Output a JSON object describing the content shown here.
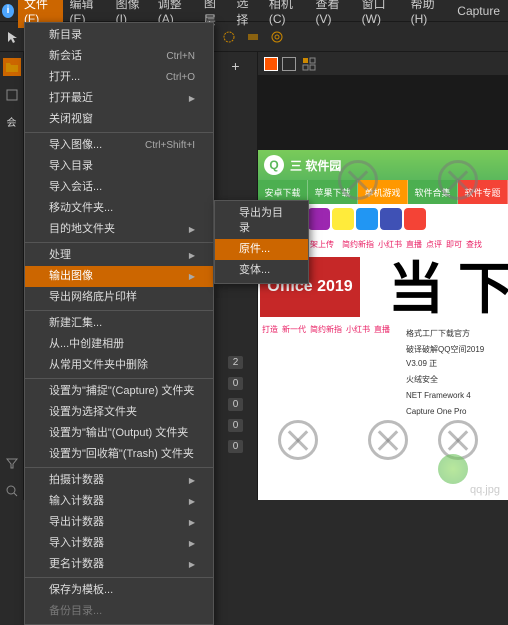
{
  "menubar": {
    "items": [
      "文件(F)",
      "编辑(E)",
      "图像(I)",
      "调整(A)",
      "图层",
      "选择",
      "相机(C)",
      "查看(V)",
      "窗口(W)",
      "帮助(H)",
      "Capture"
    ]
  },
  "dropdown": {
    "groups": [
      [
        {
          "label": "新目录",
          "shortcut": ""
        },
        {
          "label": "新会话",
          "shortcut": "Ctrl+N"
        },
        {
          "label": "打开...",
          "shortcut": "Ctrl+O"
        },
        {
          "label": "打开最近",
          "submenu": true
        },
        {
          "label": "关闭视窗",
          "shortcut": ""
        }
      ],
      [
        {
          "label": "导入图像...",
          "shortcut": "Ctrl+Shift+I"
        },
        {
          "label": "导入目录",
          "shortcut": ""
        },
        {
          "label": "导入会话...",
          "shortcut": ""
        },
        {
          "label": "移动文件夹...",
          "shortcut": ""
        },
        {
          "label": "目的地文件夹",
          "submenu": true
        }
      ],
      [
        {
          "label": "处理",
          "submenu": true
        },
        {
          "label": "输出图像",
          "submenu": true,
          "highlighted": true
        },
        {
          "label": "导出网络底片印样",
          "shortcut": ""
        }
      ],
      [
        {
          "label": "新建汇集...",
          "shortcut": ""
        },
        {
          "label": "从...中创建相册",
          "shortcut": ""
        },
        {
          "label": "从常用文件夹中删除",
          "shortcut": ""
        }
      ],
      [
        {
          "label": "设置为\"捕捉\"(Capture) 文件夹",
          "shortcut": ""
        },
        {
          "label": "设置为选择文件夹",
          "shortcut": ""
        },
        {
          "label": "设置为\"输出\"(Output) 文件夹",
          "shortcut": ""
        },
        {
          "label": "设置为\"回收箱\"(Trash) 文件夹",
          "shortcut": ""
        }
      ],
      [
        {
          "label": "拍摄计数器",
          "submenu": true
        },
        {
          "label": "输入计数器",
          "submenu": true
        },
        {
          "label": "导出计数器",
          "submenu": true
        },
        {
          "label": "导入计数器",
          "submenu": true
        },
        {
          "label": "更名计数器",
          "submenu": true
        }
      ],
      [
        {
          "label": "保存为模板...",
          "shortcut": ""
        },
        {
          "label": "备份目录...",
          "shortcut": "",
          "disabled": true
        }
      ]
    ]
  },
  "submenu": {
    "items": [
      {
        "label": "导出为目录"
      },
      {
        "label": "原件...",
        "highlighted": true
      },
      {
        "label": "变体..."
      }
    ]
  },
  "counters": [
    "2",
    "0",
    "0",
    "0",
    "0"
  ],
  "preview": {
    "site_title": "三 软件园",
    "nav": [
      "安卓下载",
      "苹果下载",
      "单机游戏",
      "软件合集",
      "软件专题"
    ],
    "office": "Office 2019",
    "big_char1": "当",
    "big_char2": "下",
    "filename": "qq.jpg",
    "links": [
      "打造",
      "新一代",
      "架上传",
      "",
      "简约新指",
      "小红书",
      "直播",
      "点评",
      "即可",
      "查找",
      "",
      ""
    ],
    "downloads": [
      "格式工厂下载官方",
      "破译破解QQ空间2019 V3.09 正",
      "火绒安全",
      "NET Framework 4",
      "Capture One Pro"
    ]
  }
}
